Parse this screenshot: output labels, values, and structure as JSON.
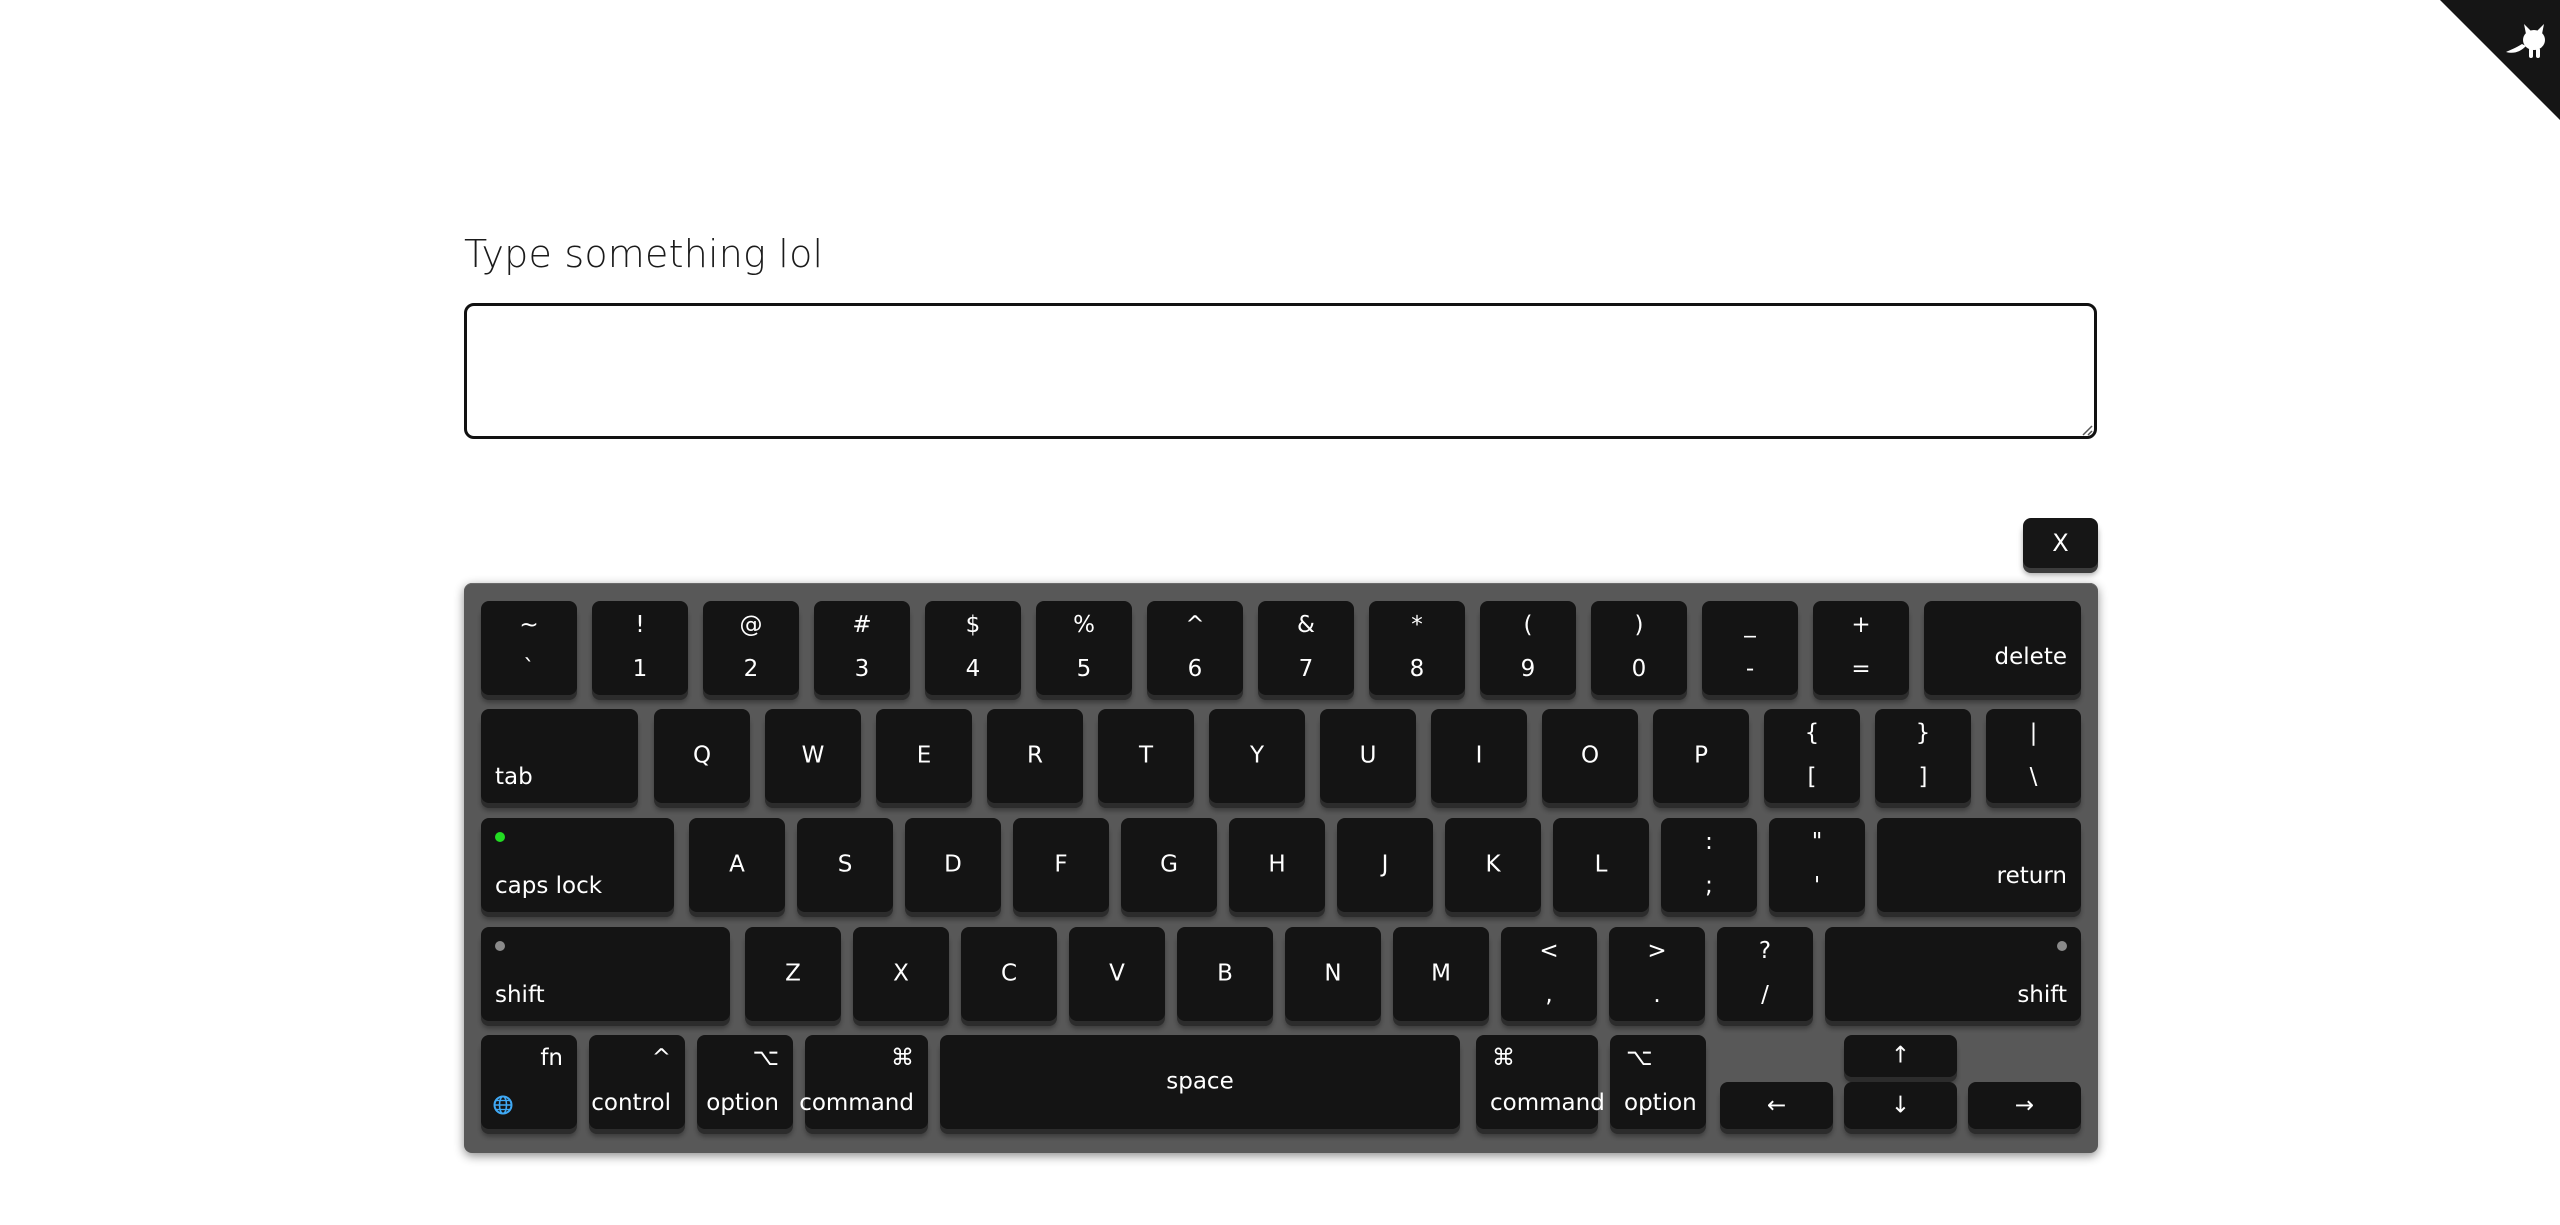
{
  "prompt": "Type something lol",
  "input": {
    "value": "",
    "placeholder": ""
  },
  "close_label": "X",
  "corner_icon": "github-octocat-icon",
  "colors": {
    "key": "#141414",
    "keyboard": "#585858",
    "caps_indicator": "#22dd22",
    "shift_indicator": "#8a8a8a",
    "globe": "#3fa9f5"
  },
  "keyboard": {
    "row1": [
      {
        "top": "~",
        "bottom": "`"
      },
      {
        "top": "!",
        "bottom": "1"
      },
      {
        "top": "@",
        "bottom": "2"
      },
      {
        "top": "#",
        "bottom": "3"
      },
      {
        "top": "$",
        "bottom": "4"
      },
      {
        "top": "%",
        "bottom": "5"
      },
      {
        "top": "^",
        "bottom": "6"
      },
      {
        "top": "&",
        "bottom": "7"
      },
      {
        "top": "*",
        "bottom": "8"
      },
      {
        "top": "(",
        "bottom": "9"
      },
      {
        "top": ")",
        "bottom": "0"
      },
      {
        "top": "_",
        "bottom": "-"
      },
      {
        "top": "+",
        "bottom": "="
      }
    ],
    "delete": "delete",
    "tab": "tab",
    "row2": [
      "Q",
      "W",
      "E",
      "R",
      "T",
      "Y",
      "U",
      "I",
      "O",
      "P"
    ],
    "row2_sym": [
      {
        "top": "{",
        "bottom": "["
      },
      {
        "top": "}",
        "bottom": "]"
      },
      {
        "top": "|",
        "bottom": "\\"
      }
    ],
    "caps_lock": "caps lock",
    "row3": [
      "A",
      "S",
      "D",
      "F",
      "G",
      "H",
      "J",
      "K",
      "L"
    ],
    "row3_sym": [
      {
        "top": ":",
        "bottom": ";"
      },
      {
        "top": "\"",
        "bottom": "'"
      }
    ],
    "return": "return",
    "shift_left": "shift",
    "row4": [
      "Z",
      "X",
      "C",
      "V",
      "B",
      "N",
      "M"
    ],
    "row4_sym": [
      {
        "top": "<",
        "bottom": ","
      },
      {
        "top": ">",
        "bottom": "."
      },
      {
        "top": "?",
        "bottom": "/"
      }
    ],
    "shift_right": "shift",
    "fn": "fn",
    "control_symbol": "^",
    "control": "control",
    "option_symbol": "⌥",
    "option": "option",
    "command_symbol": "⌘",
    "command": "command",
    "space": "space",
    "arrow_up": "↑",
    "arrow_down": "↓",
    "arrow_left": "←",
    "arrow_right": "→"
  }
}
